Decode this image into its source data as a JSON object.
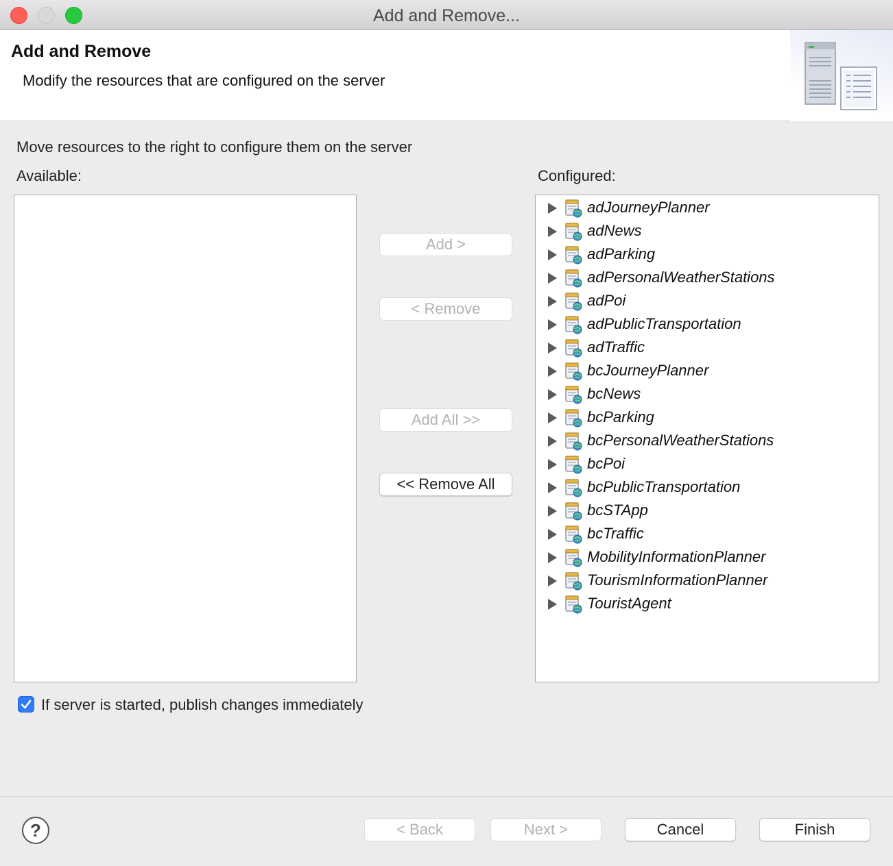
{
  "window": {
    "title": "Add and Remove..."
  },
  "header": {
    "title": "Add and Remove",
    "description": "Modify the resources that are configured on the server"
  },
  "instructions": "Move resources to the right to configure them on the server",
  "available": {
    "label": "Available:",
    "items": []
  },
  "configured": {
    "label": "Configured:",
    "items": [
      "adJourneyPlanner",
      "adNews",
      "adParking",
      "adPersonalWeatherStations",
      "adPoi",
      "adPublicTransportation",
      "adTraffic",
      "bcJourneyPlanner",
      "bcNews",
      "bcParking",
      "bcPersonalWeatherStations",
      "bcPoi",
      "bcPublicTransportation",
      "bcSTApp",
      "bcTraffic",
      "MobilityInformationPlanner",
      "TourismInformationPlanner",
      "TouristAgent"
    ]
  },
  "buttons": {
    "add": "Add >",
    "remove": "< Remove",
    "add_all": "Add All >>",
    "remove_all": "<< Remove All"
  },
  "publish_checkbox": {
    "label": "If server is started, publish changes immediately",
    "checked": true
  },
  "footer": {
    "help": "?",
    "back": "< Back",
    "next": "Next >",
    "cancel": "Cancel",
    "finish": "Finish"
  },
  "colors": {
    "accent": "#2f7cf6",
    "close": "#fe5f57",
    "zoom": "#27c93f"
  }
}
